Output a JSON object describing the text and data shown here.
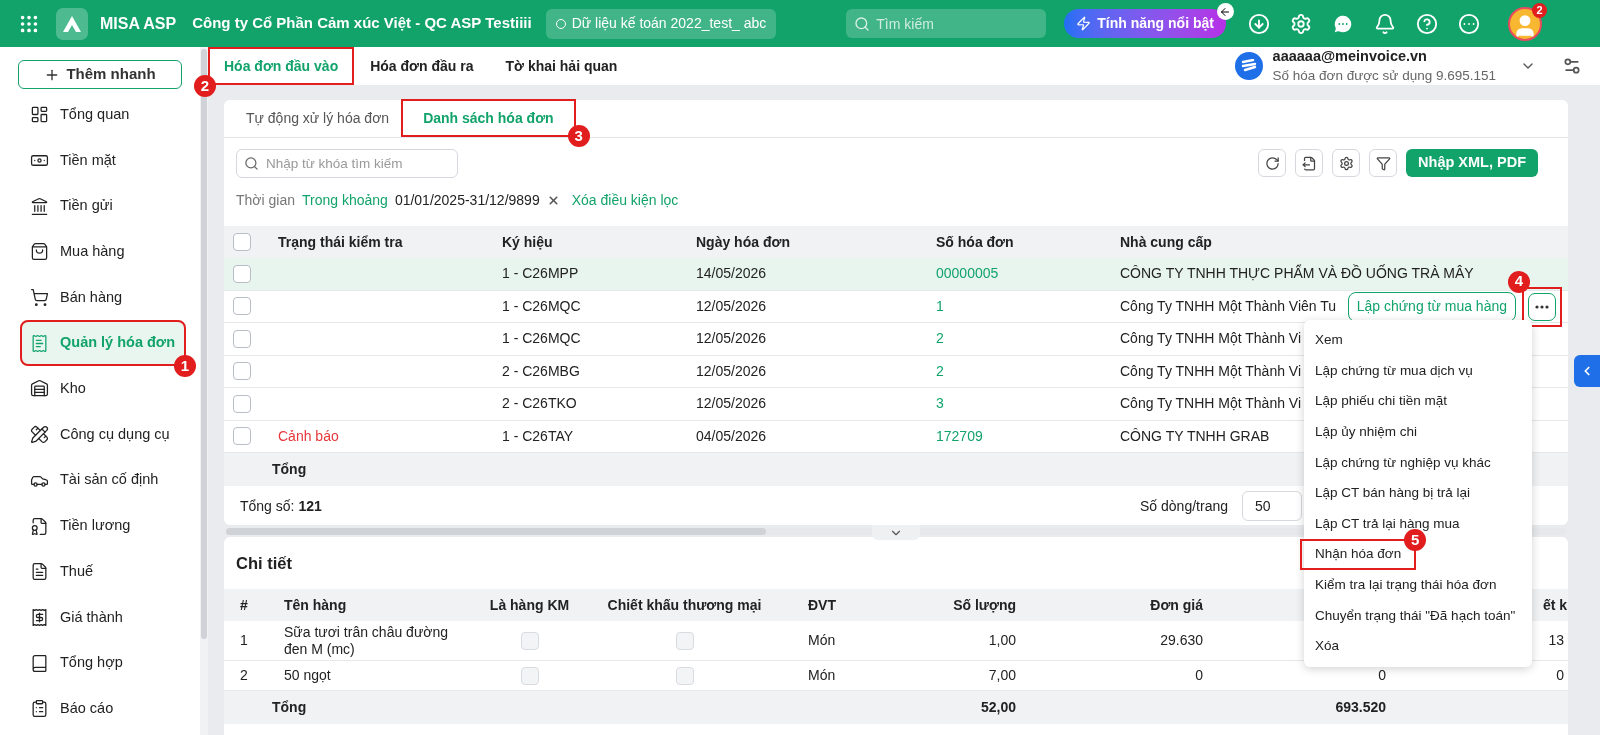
{
  "header": {
    "app_name": "MISA ASP",
    "company": "Công ty Cổ Phần Cảm xúc Việt - QC ASP Testiiii",
    "dataset": "Dữ liệu kế toán 2022_test_ abc",
    "search_placeholder": "Tìm kiếm",
    "feature_button": "Tính năng nổi bật",
    "notification_count": "2"
  },
  "sidebar": {
    "quick_add": "Thêm nhanh",
    "items": [
      {
        "label": "Tổng quan",
        "selected": false
      },
      {
        "label": "Tiền mặt",
        "selected": false
      },
      {
        "label": "Tiền gửi",
        "selected": false
      },
      {
        "label": "Mua hàng",
        "selected": false
      },
      {
        "label": "Bán hàng",
        "selected": false
      },
      {
        "label": "Quản lý hóa đơn",
        "selected": true,
        "annotation": "1"
      },
      {
        "label": "Kho",
        "selected": false
      },
      {
        "label": "Công cụ dụng cụ",
        "selected": false
      },
      {
        "label": "Tài sản cố định",
        "selected": false
      },
      {
        "label": "Tiền lương",
        "selected": false
      },
      {
        "label": "Thuế",
        "selected": false
      },
      {
        "label": "Giá thành",
        "selected": false
      },
      {
        "label": "Tổng hợp",
        "selected": false
      },
      {
        "label": "Báo cáo",
        "selected": false
      }
    ]
  },
  "top_tabs": [
    {
      "label": "Hóa đơn đầu vào",
      "selected": true,
      "annotation": "2"
    },
    {
      "label": "Hóa đơn đầu ra",
      "selected": false
    },
    {
      "label": "Tờ khai hải quan",
      "selected": false
    }
  ],
  "account": {
    "email": "aaaaaa@meinvoice.vn",
    "usage": "Số hóa đơn được sử dụng 9.695.151"
  },
  "invoice_panel": {
    "tabs": [
      {
        "label": "Tự động xử lý hóa đơn",
        "selected": false
      },
      {
        "label": "Danh sách hóa đơn",
        "selected": true,
        "annotation": "3"
      }
    ],
    "search_placeholder": "Nhập từ khóa tìm kiếm",
    "filter": {
      "label": "Thời gian",
      "mode": "Trong khoảng",
      "range": "01/01/2025-31/12/9899",
      "clear": "Xóa điều kiện lọc"
    },
    "import_button": "Nhập XML, PDF",
    "table": {
      "select_all_checked": false,
      "columns": [
        "Trạng thái kiểm tra",
        "Ký hiệu",
        "Ngày hóa đơn",
        "Số hóa đơn",
        "Nhà cung cấp"
      ],
      "rows": [
        {
          "checked": false,
          "highlighted": true,
          "symbol": "1 - C26MPP",
          "date": "14/05/2026",
          "number": "00000005",
          "supplier": "CÔNG TY TNHH THỰC PHẨM VÀ ĐỒ UỐNG TRÀ MÂY"
        },
        {
          "checked": false,
          "highlighted": false,
          "symbol": "1 - C26MQC",
          "date": "12/05/2026",
          "number": "1",
          "supplier": "Công Ty TNHH Một Thành Viên Tu",
          "actions": {
            "primary": "Lập chứng từ mua hàng",
            "more_annotation": "4"
          }
        },
        {
          "checked": false,
          "highlighted": false,
          "symbol": "1 - C26MQC",
          "date": "12/05/2026",
          "number": "2",
          "supplier": "Công Ty TNHH Một Thành Vi"
        },
        {
          "checked": false,
          "highlighted": false,
          "symbol": "2 - C26MBG",
          "date": "12/05/2026",
          "number": "2",
          "supplier": "Công Ty TNHH Một Thành Vi"
        },
        {
          "checked": false,
          "highlighted": false,
          "symbol": "2 - C26TKO",
          "date": "12/05/2026",
          "number": "3",
          "supplier": "Công Ty TNHH Một Thành Vi"
        },
        {
          "checked": false,
          "highlighted": false,
          "status": {
            "text": "Cảnh báo",
            "kind": "warning"
          },
          "symbol": "1 - C26TAY",
          "date": "04/05/2026",
          "number": "172709",
          "supplier": "CÔNG TY TNHH GRAB"
        }
      ],
      "total_label": "Tổng",
      "count_label": "Tổng số:",
      "count": "121",
      "page_size_label": "Số dòng/trang",
      "page_size": "50"
    },
    "menu": [
      {
        "label": "Xem"
      },
      {
        "label": "Lập chứng từ mua dịch vụ"
      },
      {
        "label": "Lập phiếu chi tiền mặt"
      },
      {
        "label": "Lập ủy nhiệm chi"
      },
      {
        "label": "Lập chứng từ nghiệp vụ khác"
      },
      {
        "label": "Lập CT bán hàng bị trả lại"
      },
      {
        "label": "Lập CT trả lại hàng mua"
      },
      {
        "label": "Nhận hóa đơn",
        "annotation": "5"
      },
      {
        "label": "Kiểm tra lại trạng thái hóa đơn"
      },
      {
        "label": "Chuyển trạng thái \"Đã hạch toán\""
      },
      {
        "label": "Xóa"
      }
    ]
  },
  "detail": {
    "title": "Chi tiết",
    "columns": [
      "#",
      "Tên hàng",
      "Là hàng KM",
      "Chiết khấu thương mại",
      "ĐVT",
      "Số lượng",
      "Đơn giá",
      "ết k"
    ],
    "rows": [
      {
        "index": "1",
        "name": "Sữa tươi trân châu đường đen M (mc)",
        "promo_checked": false,
        "discount_checked": false,
        "unit": "Món",
        "quantity": "1,00",
        "price": "29.630",
        "column_9": "13"
      },
      {
        "index": "2",
        "name": "50 ngọt",
        "promo_checked": false,
        "discount_checked": false,
        "unit": "Món",
        "quantity": "7,00",
        "price": "0",
        "amount": "0",
        "column_9": "0"
      }
    ],
    "total_label": "Tổng",
    "total_quantity": "52,00",
    "total_amount": "693.520"
  }
}
